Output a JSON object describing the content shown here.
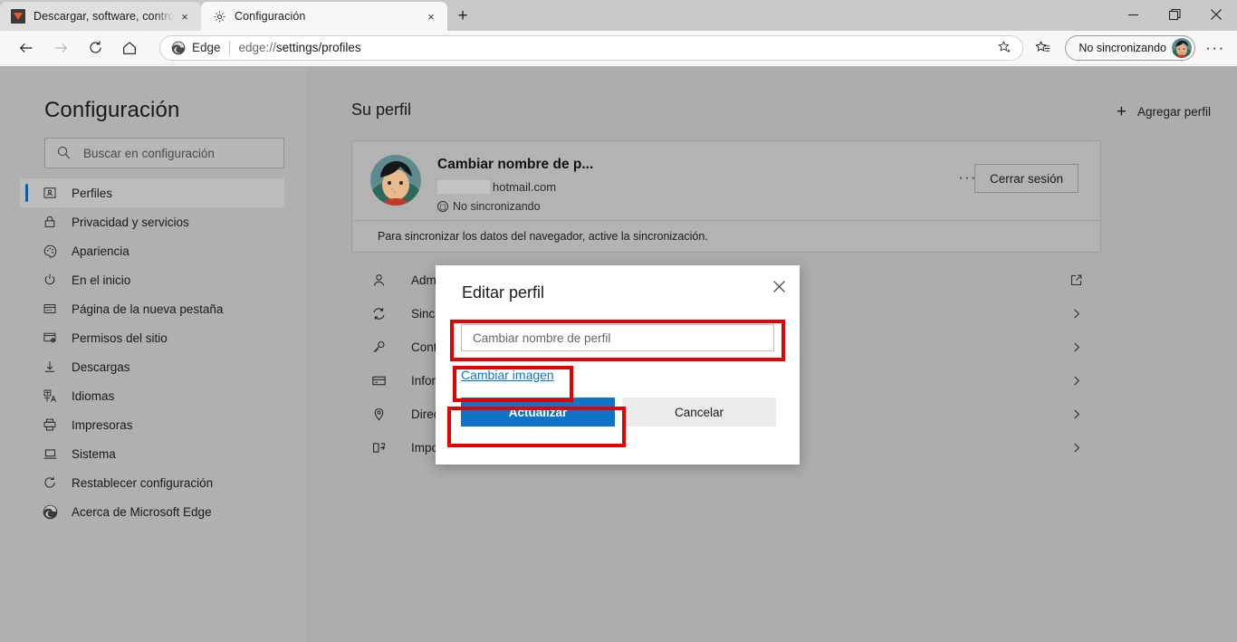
{
  "window": {
    "minimize_label": "Minimizar",
    "maximize_label": "Restaurar",
    "close_label": "Cerrar"
  },
  "tabs": [
    {
      "title": "Descargar, software, controladores",
      "favicon": "download-favicon",
      "active": false,
      "close_label": "×"
    },
    {
      "title": "Configuración",
      "favicon": "gear-icon",
      "active": true,
      "close_label": "×"
    }
  ],
  "newtab_label": "+",
  "toolbar": {
    "back_label": "Atrás",
    "forward_label": "Adelante",
    "refresh_label": "Actualizar",
    "home_label": "Inicio",
    "omnibox": {
      "brand": "Edge",
      "url_prefix": "edge://",
      "url_path": "settings/profiles",
      "favorite_icon": "star-icon"
    },
    "favorites_label": "Favoritos",
    "sync_status": "No sincronizando",
    "more_label": "···"
  },
  "sidebar": {
    "title": "Configuración",
    "search_placeholder": "Buscar en configuración",
    "items": [
      {
        "label": "Perfiles",
        "icon": "profile-card-icon",
        "selected": true
      },
      {
        "label": "Privacidad y servicios",
        "icon": "lock-icon",
        "selected": false
      },
      {
        "label": "Apariencia",
        "icon": "palette-icon",
        "selected": false
      },
      {
        "label": "En el inicio",
        "icon": "power-icon",
        "selected": false
      },
      {
        "label": "Página de la nueva pestaña",
        "icon": "newtab-icon",
        "selected": false
      },
      {
        "label": "Permisos del sitio",
        "icon": "site-permissions-icon",
        "selected": false
      },
      {
        "label": "Descargas",
        "icon": "download-arrow-icon",
        "selected": false
      },
      {
        "label": "Idiomas",
        "icon": "language-icon",
        "selected": false
      },
      {
        "label": "Impresoras",
        "icon": "printer-icon",
        "selected": false
      },
      {
        "label": "Sistema",
        "icon": "laptop-icon",
        "selected": false
      },
      {
        "label": "Restablecer configuración",
        "icon": "reset-icon",
        "selected": false
      },
      {
        "label": "Acerca de Microsoft Edge",
        "icon": "edge-logo-icon",
        "selected": false
      }
    ]
  },
  "main": {
    "section_title": "Su perfil",
    "add_profile_label": "Agregar perfil",
    "add_profile_icon": "plus-icon",
    "profile": {
      "name": "Cambiar nombre de p...",
      "email_domain": "hotmail.com",
      "email_redacted": true,
      "sync_status": "No sincronizando",
      "sync_icon": "sync-off-icon",
      "more_label": "···",
      "signout_label": "Cerrar sesión",
      "note": "Para sincronizar los datos del navegador, active la sincronización."
    },
    "rows": [
      {
        "label": "Administrar configuración del perfil",
        "icon": "person-icon",
        "end_icon": "external-link-icon"
      },
      {
        "label": "Sincronización",
        "icon": "sync-icon",
        "end_icon": "chevron-right-icon"
      },
      {
        "label": "Contraseñas",
        "icon": "key-icon",
        "end_icon": "chevron-right-icon"
      },
      {
        "label": "Información de pago",
        "icon": "card-icon",
        "end_icon": "chevron-right-icon"
      },
      {
        "label": "Direcciones y más",
        "icon": "location-pin-icon",
        "end_icon": "chevron-right-icon"
      },
      {
        "label": "Importar datos de navegador",
        "icon": "import-icon",
        "end_icon": "chevron-right-icon"
      }
    ]
  },
  "dialog": {
    "title": "Editar perfil",
    "close_label": "×",
    "name_placeholder": "Cambiar nombre de perfil",
    "name_value": "",
    "change_image_label": "Cambiar imagen",
    "primary_label": "Actualizar",
    "secondary_label": "Cancelar"
  },
  "annotations": {
    "color": "#e00000",
    "boxes": [
      "name-input",
      "change-image-link",
      "update-button"
    ]
  }
}
